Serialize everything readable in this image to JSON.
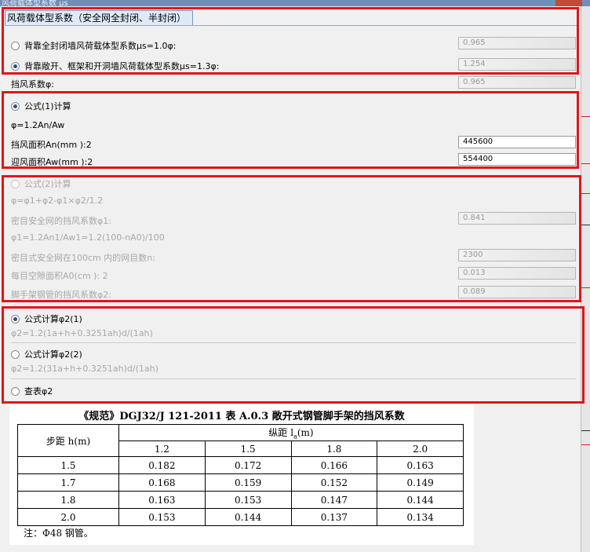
{
  "tab_label": "风荷载体型系数（安全网全封闭、半封闭）",
  "shape": {
    "opt1_label": "背靠全封闭墙风荷载体型系数μs=1.0φ:",
    "opt1_value": "0.965",
    "opt2_label": "背靠敞开、框架和开洞墙风荷载体型系数μs=1.3φ:",
    "opt2_value": "1.254"
  },
  "shield": {
    "label": "挡风系数φ:",
    "value": "0.965"
  },
  "formula1": {
    "label": "公式(1)计算",
    "expr": "φ=1.2An/Aw",
    "an_label": "挡风面积An(mm ):2",
    "an_value": "445600",
    "aw_label": "迎风面积Aw(mm ):2",
    "aw_value": "554400"
  },
  "formula2": {
    "label": "公式(2)计算",
    "expr": "φ=φ1+φ2-φ1×φ2/1.2",
    "phi1_label": "密目安全网的挡风系数φ1:",
    "phi1_value": "0.841",
    "phi1_expr": "φ1=1.2An1/Aw1=1.2(100-nA0)/100",
    "n_label": "密目式安全网在100cm 内的网目数n:",
    "n_value": "2300",
    "a0_label": "每目空隙面积A0(cm ): 2",
    "a0_value": "0.013",
    "phi2_label": "脚手架钢管的挡风系数φ2:",
    "phi2_value": "0.089"
  },
  "phi2_calc": {
    "opt1_label": "公式计算φ2(1)",
    "opt1_expr": "φ2=1.2(1a+h+0.3251ah)d/(1ah)",
    "opt2_label": "公式计算φ2(2)",
    "opt2_expr": "φ2=1.2(31a+h+0.3251ah)d/(1ah)",
    "opt3_label": "查表φ2"
  },
  "table": {
    "title": "《规范》DGJ32/J 121-2011 表 A.0.3   敞开式钢管脚手架的挡风系数",
    "row_header": "步距 h(m)",
    "col_group_header": "纵距 l",
    "col_group_sub": "a",
    "col_group_unit": "(m)",
    "columns": [
      "1.2",
      "1.5",
      "1.8",
      "2.0"
    ],
    "rows": [
      {
        "h": "1.5",
        "values": [
          "0.182",
          "0.172",
          "0.166",
          "0.163"
        ]
      },
      {
        "h": "1.7",
        "values": [
          "0.168",
          "0.159",
          "0.152",
          "0.149"
        ]
      },
      {
        "h": "1.8",
        "values": [
          "0.163",
          "0.153",
          "0.147",
          "0.144"
        ]
      },
      {
        "h": "2.0",
        "values": [
          "0.153",
          "0.144",
          "0.137",
          "0.134"
        ]
      }
    ],
    "note": "注：Φ48 钢管。"
  }
}
